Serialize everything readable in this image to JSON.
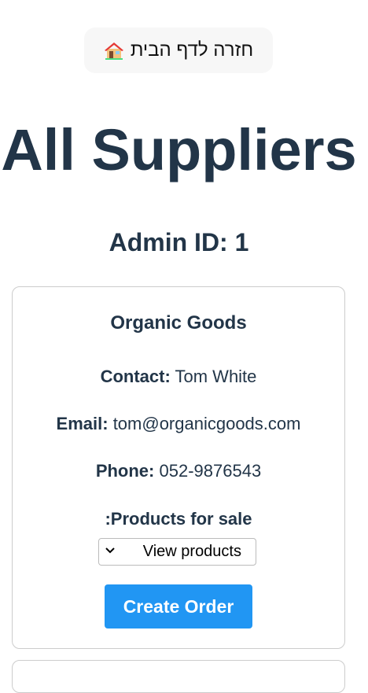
{
  "header": {
    "home_button_label": "חזרה לדף הבית",
    "home_icon": "house-icon",
    "title": "All Suppliers",
    "admin_id": "Admin ID: 1"
  },
  "suppliers": [
    {
      "name": "Organic Goods",
      "contact_label": "Contact:",
      "contact": "Tom White",
      "email_label": "Email:",
      "email": "tom@organicgoods.com",
      "phone_label": "Phone:",
      "phone": "052-9876543",
      "products_label": ":Products for sale",
      "products_select": "View products",
      "create_order_label": "Create Order"
    }
  ],
  "colors": {
    "primary": "#2196f3",
    "text": "#223548"
  }
}
